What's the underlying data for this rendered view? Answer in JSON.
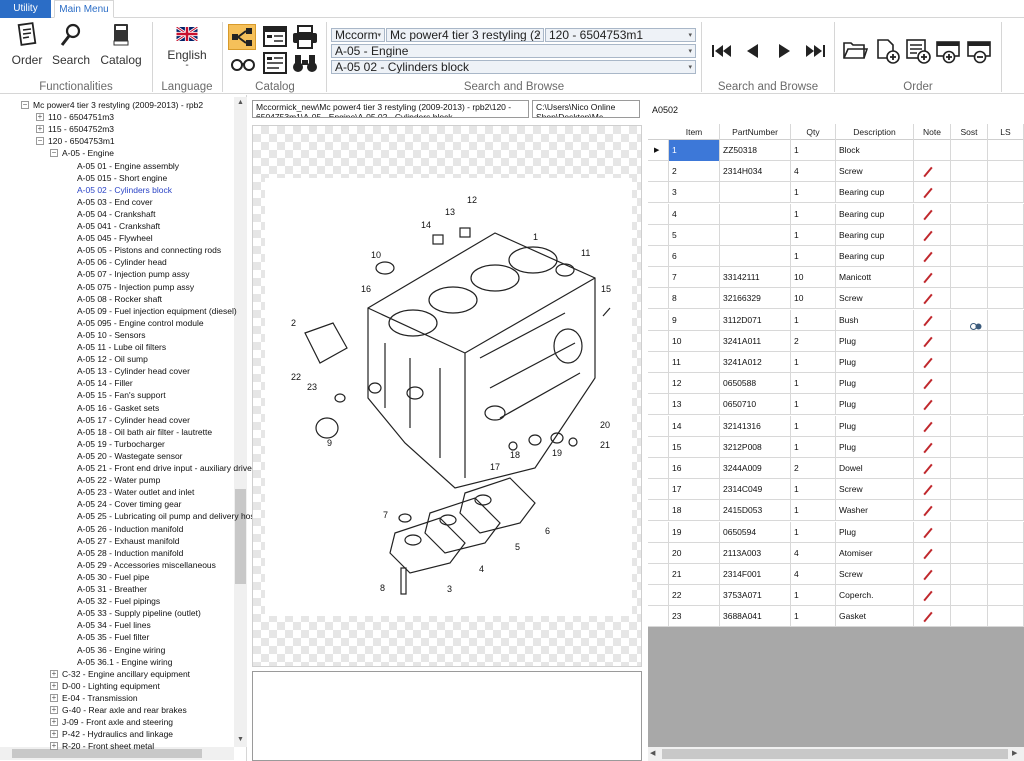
{
  "menu": {
    "tabs": [
      "Utility",
      "Main Menu"
    ]
  },
  "ribbon": {
    "functionalities": {
      "label": "Functionalities",
      "buttons": [
        "Order",
        "Search",
        "Catalog"
      ]
    },
    "language": {
      "label": "Language",
      "value": "English",
      "dash": "-"
    },
    "catalog": {
      "label": "Catalog"
    },
    "search_browse": {
      "label": "Search and Browse",
      "combos": [
        "Mccorm",
        "Mc power4 tier 3 restyling (2",
        "120 - 6504753m1",
        "A-05 - Engine",
        "A-05 02 - Cylinders block"
      ]
    },
    "nav": {
      "label": "Search and Browse"
    },
    "order": {
      "label": "Order"
    }
  },
  "paths": {
    "left": "Mccormick_new\\Mc power4 tier 3 restyling (2009-2013) - rpb2\\120 - 6504753m1\\A-05 - Engine\\A-05 02 - Cylinders block",
    "right": "C:\\Users\\Nico Online Shop\\Desktop\\Mc Cormick",
    "code": "A0502"
  },
  "tree": {
    "root": "Mc power4 tier 3 restyling (2009-2013) - rpb2",
    "models": [
      "110 - 6504751m3",
      "115 - 6504752m3",
      "120 - 6504753m1"
    ],
    "engine": "A-05 - Engine",
    "engine_items": [
      "A-05 01 - Engine assembly",
      "A-05 015 - Short engine",
      "A-05 02 - Cylinders block",
      "A-05 03 - End cover",
      "A-05 04 - Crankshaft",
      "A-05 041 - Crankshaft",
      "A-05 045 - Flywheel",
      "A-05 05 - Pistons and connecting rods",
      "A-05 06 - Cylinder head",
      "A-05 07 - Injection pump assy",
      "A-05 075 - Injection pump assy",
      "A-05 08 - Rocker shaft",
      "A-05 09 - Fuel injection equipment (diesel)",
      "A-05 095 - Engine control module",
      "A-05 10 - Sensors",
      "A-05 11 - Lube oil filters",
      "A-05 12 - Oil sump",
      "A-05 13 - Cylinder head cover",
      "A-05 14 - Filler",
      "A-05 15 - Fan's support",
      "A-05 16 - Gasket sets",
      "A-05 17 - Cylinder head cover",
      "A-05 18 - Oil bath air filter - lautrette",
      "A-05 19 - Turbocharger",
      "A-05 20 - Wastegate sensor",
      "A-05 21 - Front end drive input - auxiliary drive",
      "A-05 22 - Water pump",
      "A-05 23 - Water outlet and inlet",
      "A-05 24 - Cover timing gear",
      "A-05 25 - Lubricating oil pump and delivery hoses",
      "A-05 26 - Induction manifold",
      "A-05 27 - Exhaust manifold",
      "A-05 28 - Induction manifold",
      "A-05 29 - Accessories miscellaneous",
      "A-05 30 - Fuel pipe",
      "A-05 31 - Breather",
      "A-05 32 - Fuel pipings",
      "A-05 33 - Supply pipeline (outlet)",
      "A-05 34 - Fuel lines",
      "A-05 35 - Fuel filter",
      "A-05 36 - Engine wiring",
      "A-05 36.1 - Engine wiring"
    ],
    "groups": [
      "C-32 - Engine ancillary equipment",
      "D-00 - Lighting equipment",
      "E-04 - Transmission",
      "G-40 - Rear axle and rear brakes",
      "J-09 - Front axle and steering",
      "P-42 - Hydraulics and linkage",
      "R-20 - Front sheet metal"
    ]
  },
  "grid": {
    "columns": [
      "Item",
      "PartNumber",
      "Qty",
      "Description",
      "Note",
      "Sost",
      "LS"
    ],
    "rows": [
      [
        "1",
        "ZZ50318",
        "1",
        "Block"
      ],
      [
        "2",
        "2314H034",
        "4",
        "Screw"
      ],
      [
        "3",
        "",
        "1",
        "Bearing cup"
      ],
      [
        "4",
        "",
        "1",
        "Bearing cup"
      ],
      [
        "5",
        "",
        "1",
        "Bearing cup"
      ],
      [
        "6",
        "",
        "1",
        "Bearing cup"
      ],
      [
        "7",
        "33142111",
        "10",
        "Manicott"
      ],
      [
        "8",
        "32166329",
        "10",
        "Screw"
      ],
      [
        "9",
        "3112D071",
        "1",
        "Bush"
      ],
      [
        "10",
        "3241A011",
        "2",
        "Plug"
      ],
      [
        "11",
        "3241A012",
        "1",
        "Plug"
      ],
      [
        "12",
        "0650588",
        "1",
        "Plug"
      ],
      [
        "13",
        "0650710",
        "1",
        "Plug"
      ],
      [
        "14",
        "32141316",
        "1",
        "Plug"
      ],
      [
        "15",
        "3212P008",
        "1",
        "Plug"
      ],
      [
        "16",
        "3244A009",
        "2",
        "Dowel"
      ],
      [
        "17",
        "2314C049",
        "1",
        "Screw"
      ],
      [
        "18",
        "2415D053",
        "1",
        "Washer"
      ],
      [
        "19",
        "0650594",
        "1",
        "Plug"
      ],
      [
        "20",
        "2113A003",
        "4",
        "Atomiser"
      ],
      [
        "21",
        "2314F001",
        "4",
        "Screw"
      ],
      [
        "22",
        "3753A071",
        "1",
        "Coperch."
      ],
      [
        "23",
        "3688A041",
        "1",
        "Gasket"
      ]
    ],
    "note_rows": [
      2,
      3,
      4,
      5,
      6,
      7,
      8,
      9,
      10,
      11,
      12,
      13,
      14,
      15,
      16,
      17,
      18,
      19,
      20,
      21,
      22,
      23
    ],
    "sost_rows": [
      9
    ]
  },
  "drawing": {
    "callouts": [
      "1",
      "2",
      "3",
      "4",
      "5",
      "6",
      "7",
      "8",
      "9",
      "10",
      "11",
      "12",
      "13",
      "14",
      "15",
      "16",
      "17",
      "18",
      "19",
      "20",
      "21",
      "22",
      "23"
    ]
  },
  "colors": {
    "accent": "#2b6dc6",
    "note_pencil": "#c0282d",
    "selected_tree": "#2b44c6"
  }
}
